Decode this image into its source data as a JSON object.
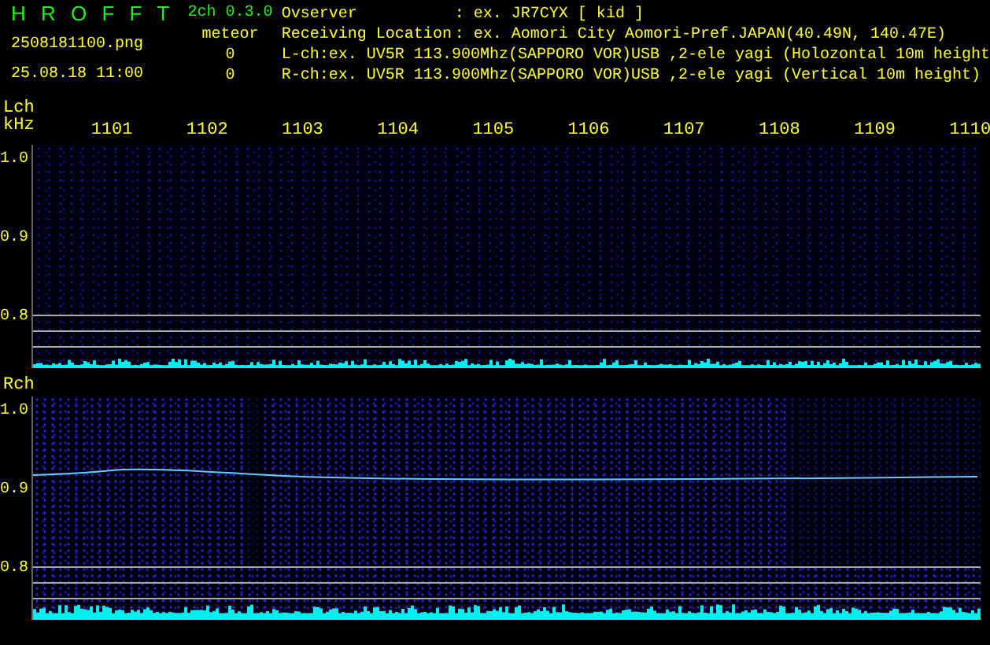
{
  "header": {
    "title": "H R O F F T",
    "version": "2ch 0.3.0",
    "filename": "2508181100.png",
    "datetime": "25.08.18 11:00",
    "meteor_label": "meteor",
    "meteor_counts": [
      "0",
      "0"
    ]
  },
  "info": [
    {
      "label": "Ovserver",
      "value": ": ex. JR7CYX [ kid ]"
    },
    {
      "label": "Receiving Location",
      "value": ": ex. Aomori City Aomori-Pref.JAPAN(40.49N, 140.47E)"
    },
    {
      "value": "L-ch:ex. UV5R 113.900Mhz(SAPPORO VOR)USB ,2-ele yagi (Holozontal 10m height"
    },
    {
      "value": "R-ch:ex. UV5R 113.900Mhz(SAPPORO VOR)USB ,2-ele yagi (Vertical 10m height)"
    }
  ],
  "frequencies": [
    "1101",
    "1102",
    "1103",
    "1104",
    "1105",
    "1106",
    "1107",
    "1108",
    "1109",
    "1110"
  ],
  "channels": [
    {
      "name": "Lch",
      "unit": "kHz",
      "yticks": [
        "1.0",
        "0.9",
        "0.8"
      ],
      "kind": "quiet"
    },
    {
      "name": "Rch",
      "yticks": [
        "1.0",
        "0.9",
        "0.8"
      ],
      "kind": "echo"
    }
  ]
}
